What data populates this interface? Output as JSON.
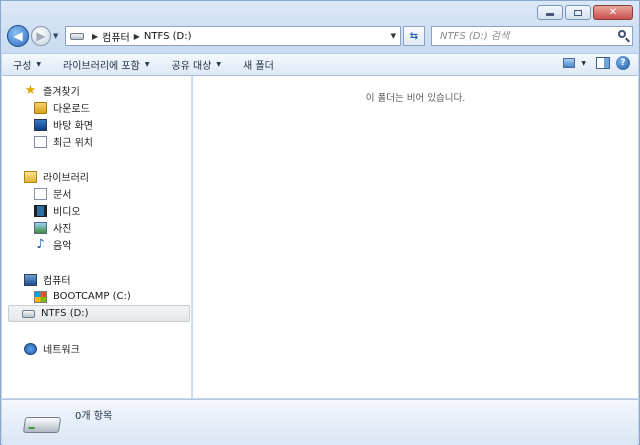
{
  "window": {
    "caption_buttons": [
      "minimize",
      "maximize",
      "close"
    ]
  },
  "nav": {
    "breadcrumb": [
      "컴퓨터",
      "NTFS (D:)"
    ],
    "search_placeholder": "NTFS (D:) 검색"
  },
  "commands": [
    {
      "label": "구성",
      "has_dropdown": true
    },
    {
      "label": "라이브러리에 포함",
      "has_dropdown": true
    },
    {
      "label": "공유 대상",
      "has_dropdown": true
    },
    {
      "label": "새 폴더",
      "has_dropdown": false
    }
  ],
  "sidebar": {
    "favorites": {
      "label": "즐겨찾기",
      "items": [
        "다운로드",
        "바탕 화면",
        "최근 위치"
      ]
    },
    "libraries": {
      "label": "라이브러리",
      "items": [
        "문서",
        "비디오",
        "사진",
        "음악"
      ]
    },
    "computer": {
      "label": "컴퓨터",
      "items": [
        "BOOTCAMP (C:)",
        "NTFS (D:)"
      ],
      "selected": "NTFS (D:)"
    },
    "network": {
      "label": "네트워크"
    }
  },
  "content": {
    "empty_message": "이 폴더는 비어 있습니다."
  },
  "details": {
    "item_count": "0개 항목"
  }
}
